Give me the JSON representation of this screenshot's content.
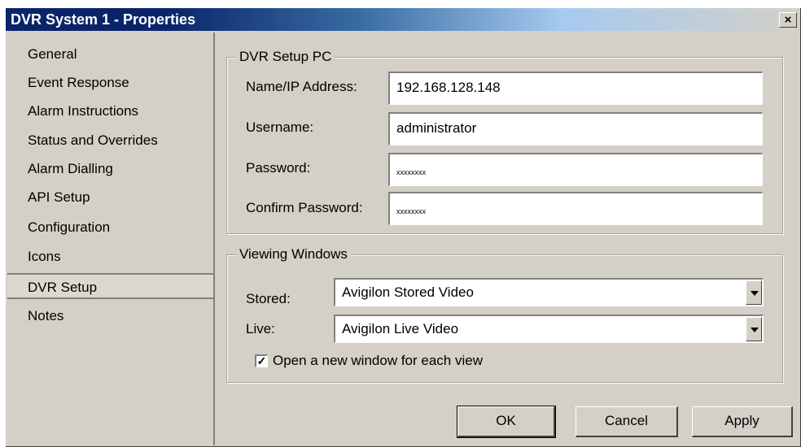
{
  "window": {
    "title": "DVR System 1 - Properties",
    "close_glyph": "×"
  },
  "sidebar": {
    "items": [
      {
        "label": "General"
      },
      {
        "label": "Event Response"
      },
      {
        "label": "Alarm Instructions"
      },
      {
        "label": "Status and Overrides"
      },
      {
        "label": "Alarm Dialling"
      },
      {
        "label": "API Setup"
      },
      {
        "label": "Configuration"
      },
      {
        "label": "Icons"
      },
      {
        "label": "DVR Setup",
        "selected": true
      },
      {
        "label": "Notes"
      }
    ]
  },
  "setup_pc": {
    "legend": "DVR Setup PC",
    "name_label": "Name/IP Address:",
    "name_value": "192.168.128.148",
    "username_label": "Username:",
    "username_value": "administrator",
    "password_label": "Password:",
    "password_value": "xxxxxxxx",
    "confirm_label": "Confirm Password:",
    "confirm_value": "xxxxxxxx"
  },
  "viewing": {
    "legend": "Viewing Windows",
    "stored_label": "Stored:",
    "stored_value": "Avigilon Stored Video",
    "live_label": "Live:",
    "live_value": "Avigilon Live Video",
    "new_window_label": "Open a new window for each view",
    "new_window_checked": true,
    "check_glyph": "✓"
  },
  "buttons": {
    "ok": "OK",
    "cancel": "Cancel",
    "apply": "Apply"
  }
}
